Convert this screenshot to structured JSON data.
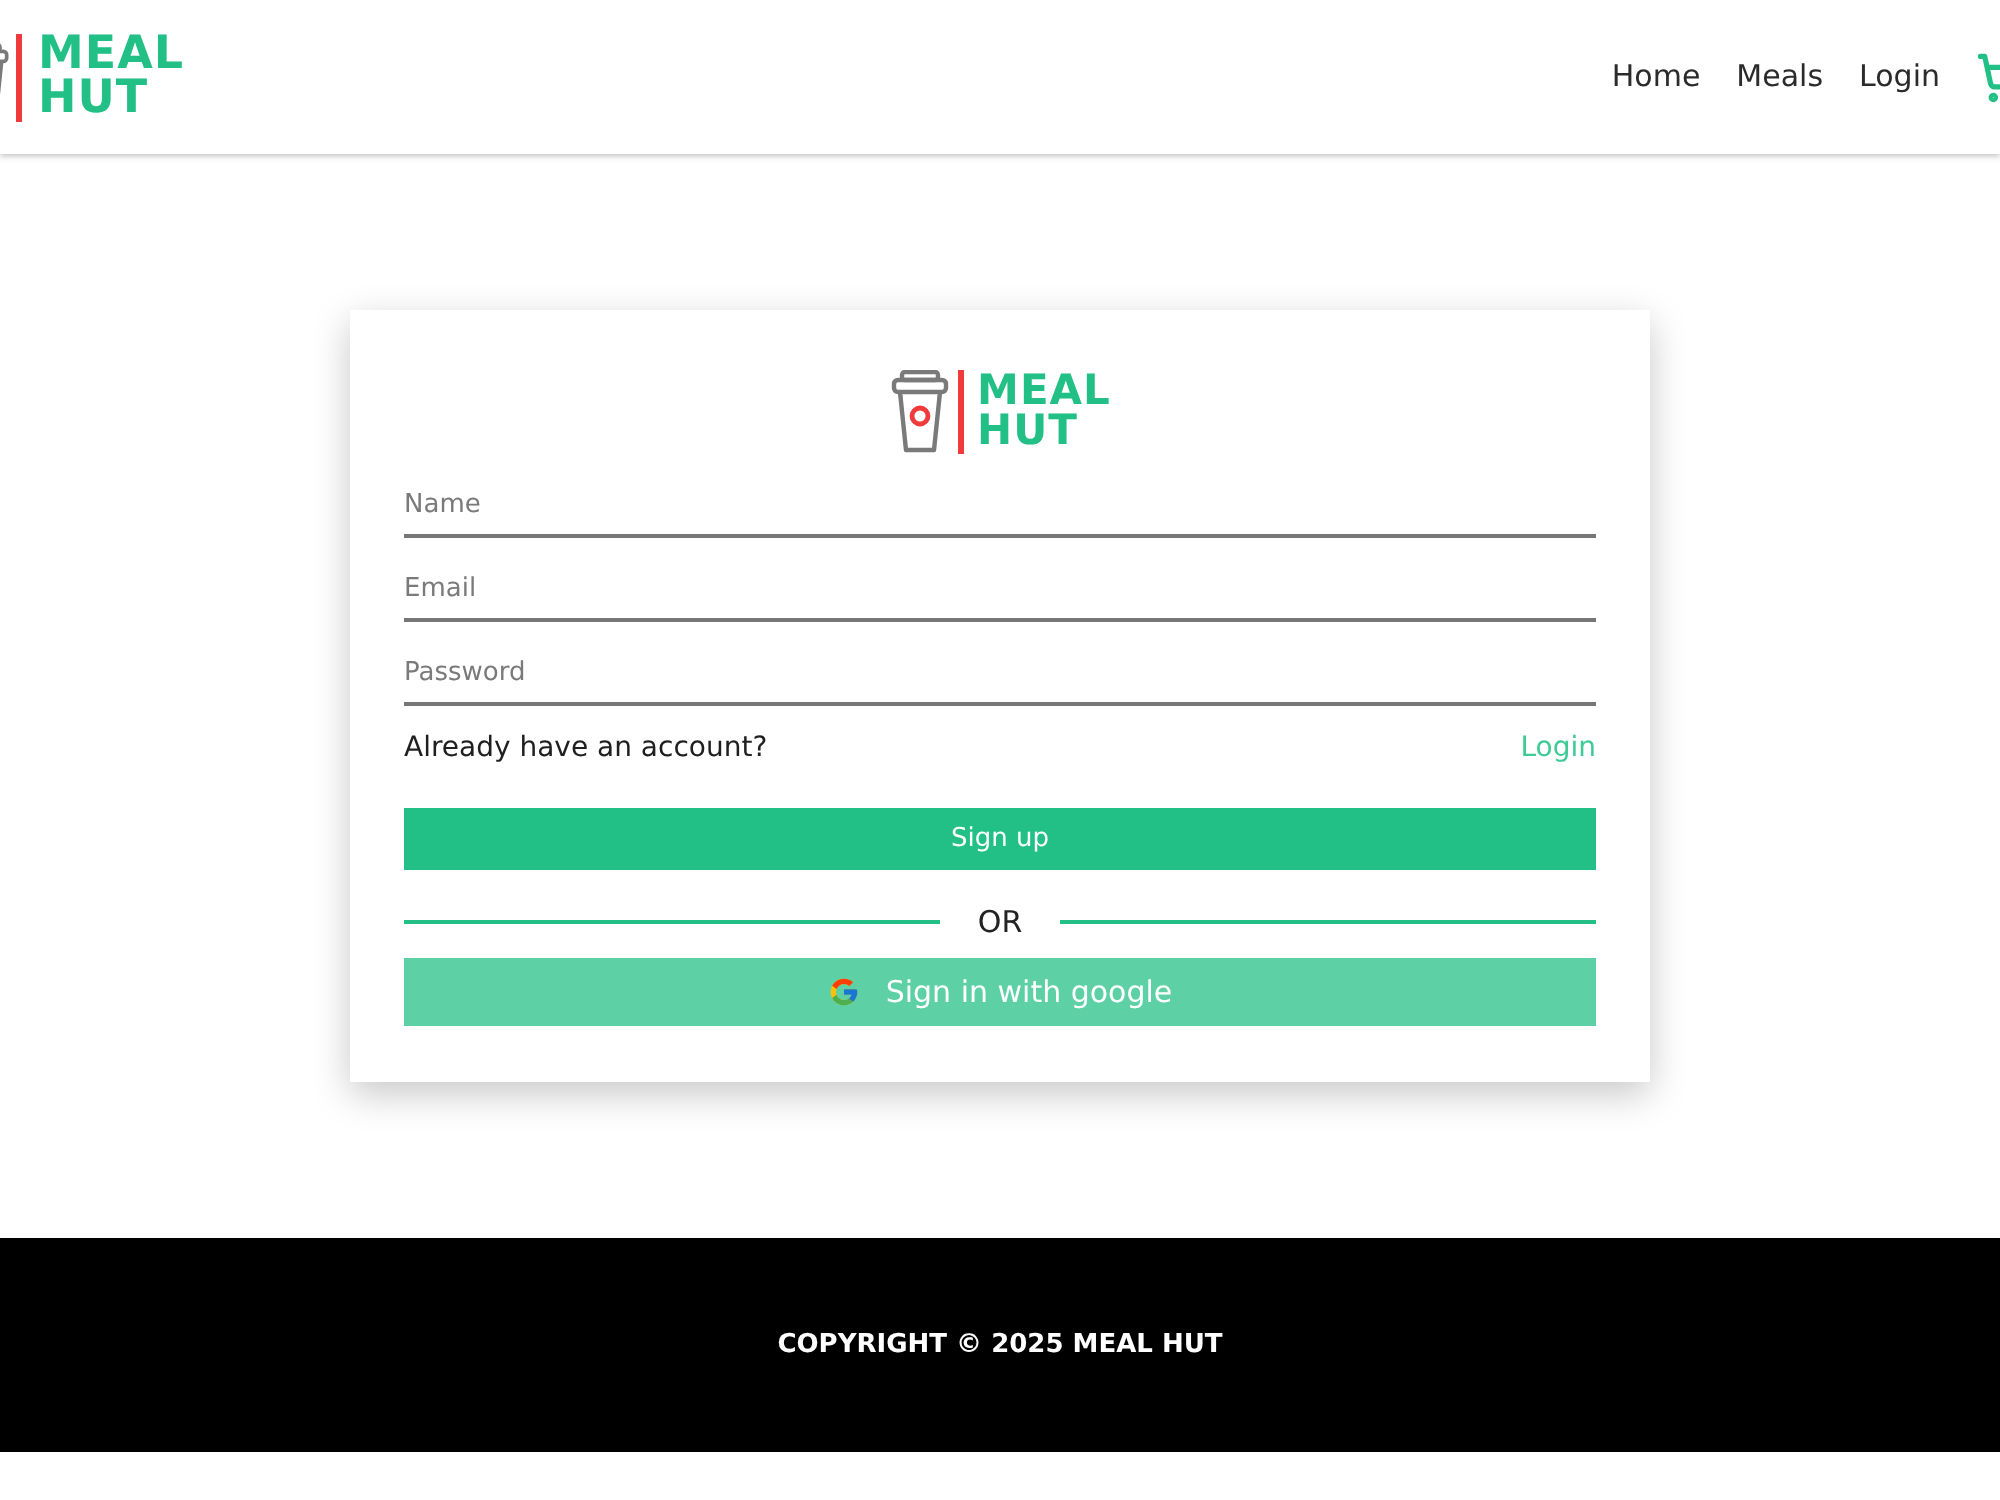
{
  "header": {
    "logo": {
      "line1": "MEAL",
      "line2": "HUT"
    },
    "nav": [
      {
        "label": "Home"
      },
      {
        "label": "Meals"
      },
      {
        "label": "Login"
      }
    ]
  },
  "signup_card": {
    "logo": {
      "line1": "MEAL",
      "line2": "HUT"
    },
    "fields": [
      {
        "placeholder": "Name"
      },
      {
        "placeholder": "Email"
      },
      {
        "placeholder": "Password"
      }
    ],
    "account_prompt": "Already have an account?",
    "login_link": "Login",
    "signup_button": "Sign up",
    "divider_text": "OR",
    "google_button": "Sign in with google"
  },
  "footer": {
    "text": "COPYRIGHT © 2025 MEAL HUT"
  }
}
